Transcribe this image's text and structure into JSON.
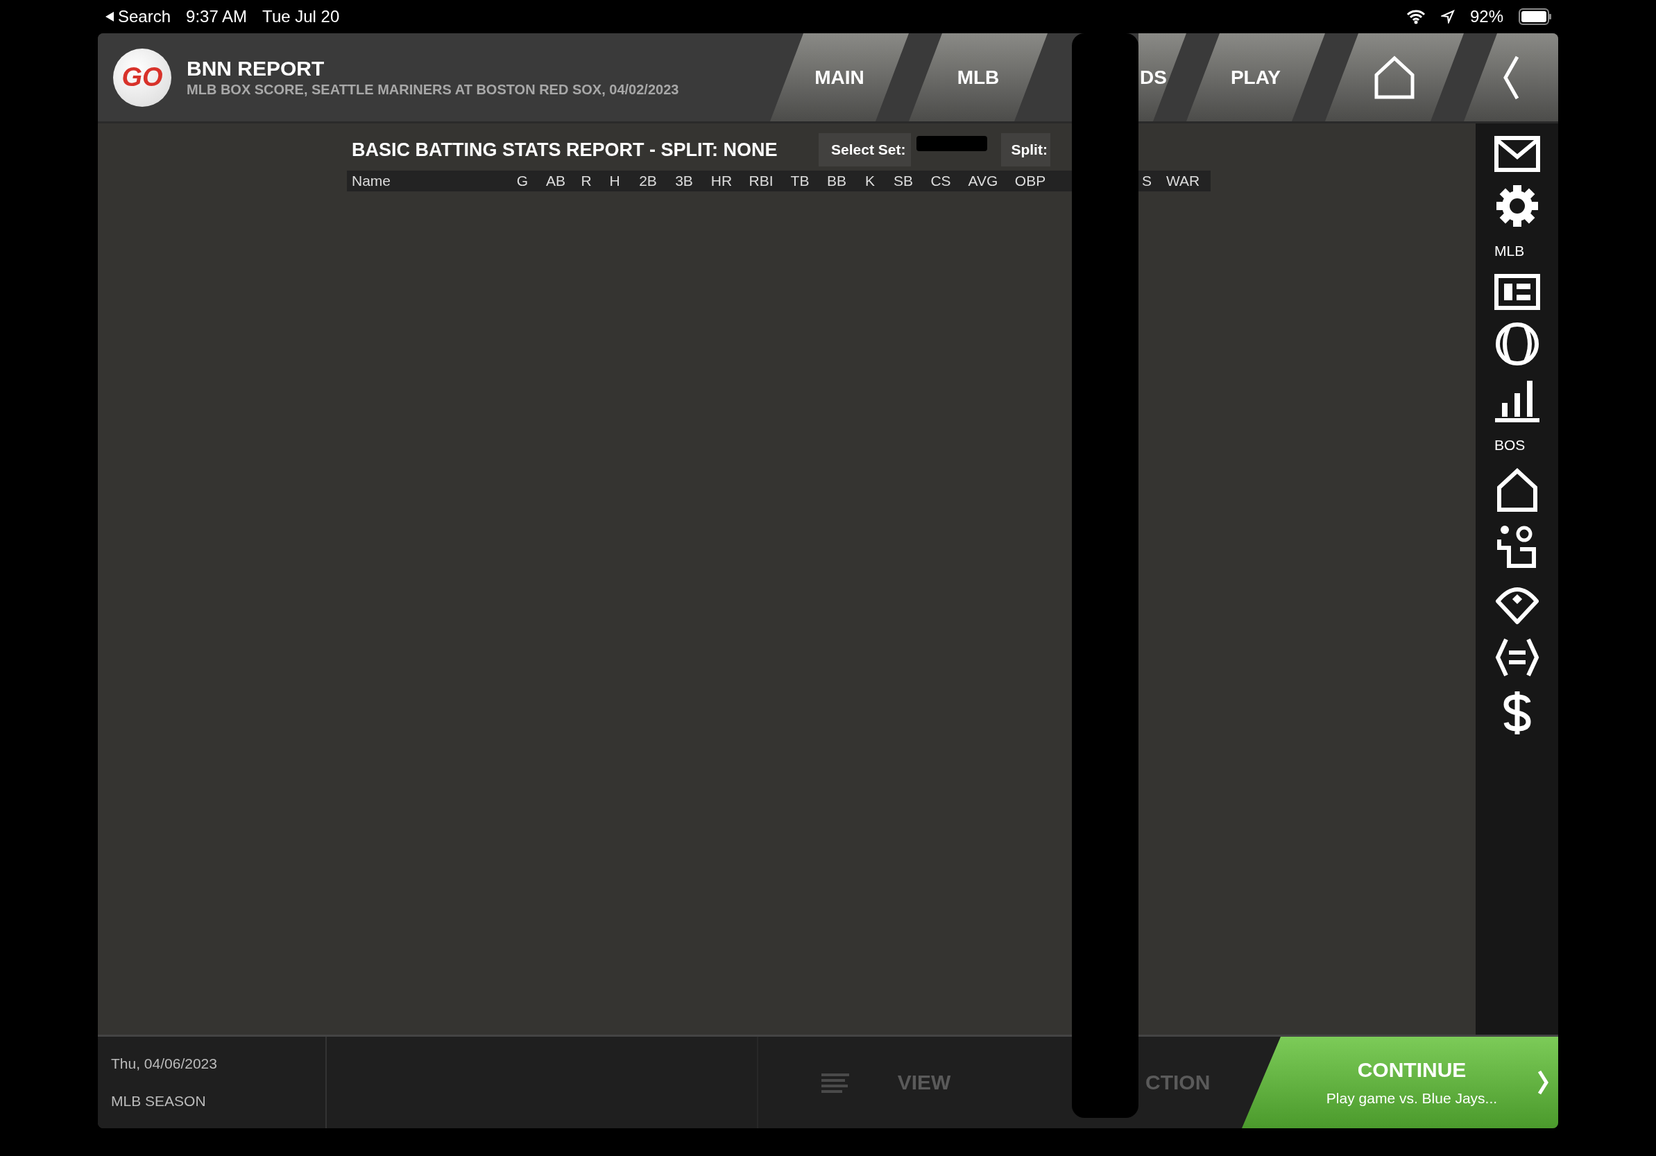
{
  "status_bar": {
    "back_label": "Search",
    "time": "9:37 AM",
    "date": "Tue Jul 20",
    "battery": "92%"
  },
  "header": {
    "logo_text": "GO",
    "title": "BNN REPORT",
    "subtitle": "MLB BOX SCORE, SEATTLE MARINERS AT BOSTON RED SOX, 04/02/2023"
  },
  "tabs": [
    {
      "label": "MAIN"
    },
    {
      "label": "MLB"
    },
    {
      "label": "DS"
    },
    {
      "label": "PLAY"
    }
  ],
  "sidebar": {
    "sections": [
      {
        "label": "MLB"
      },
      {
        "label": "BOS"
      }
    ]
  },
  "report": {
    "title": "BASIC BATTING STATS REPORT - SPLIT: NONE",
    "select_set_label": "Select Set:",
    "split_label": "Split:",
    "columns": [
      "Name",
      "G",
      "AB",
      "R",
      "H",
      "2B",
      "3B",
      "HR",
      "RBI",
      "TB",
      "BB",
      "K",
      "SB",
      "CS",
      "AVG",
      "OBP",
      "S",
      "WAR"
    ]
  },
  "footer": {
    "date": "Thu, 04/06/2023",
    "season": "MLB SEASON",
    "view_label": "VIEW",
    "action_label": "CTION",
    "continue": {
      "title": "CONTINUE",
      "subtitle": "Play game vs. Blue Jays..."
    }
  }
}
